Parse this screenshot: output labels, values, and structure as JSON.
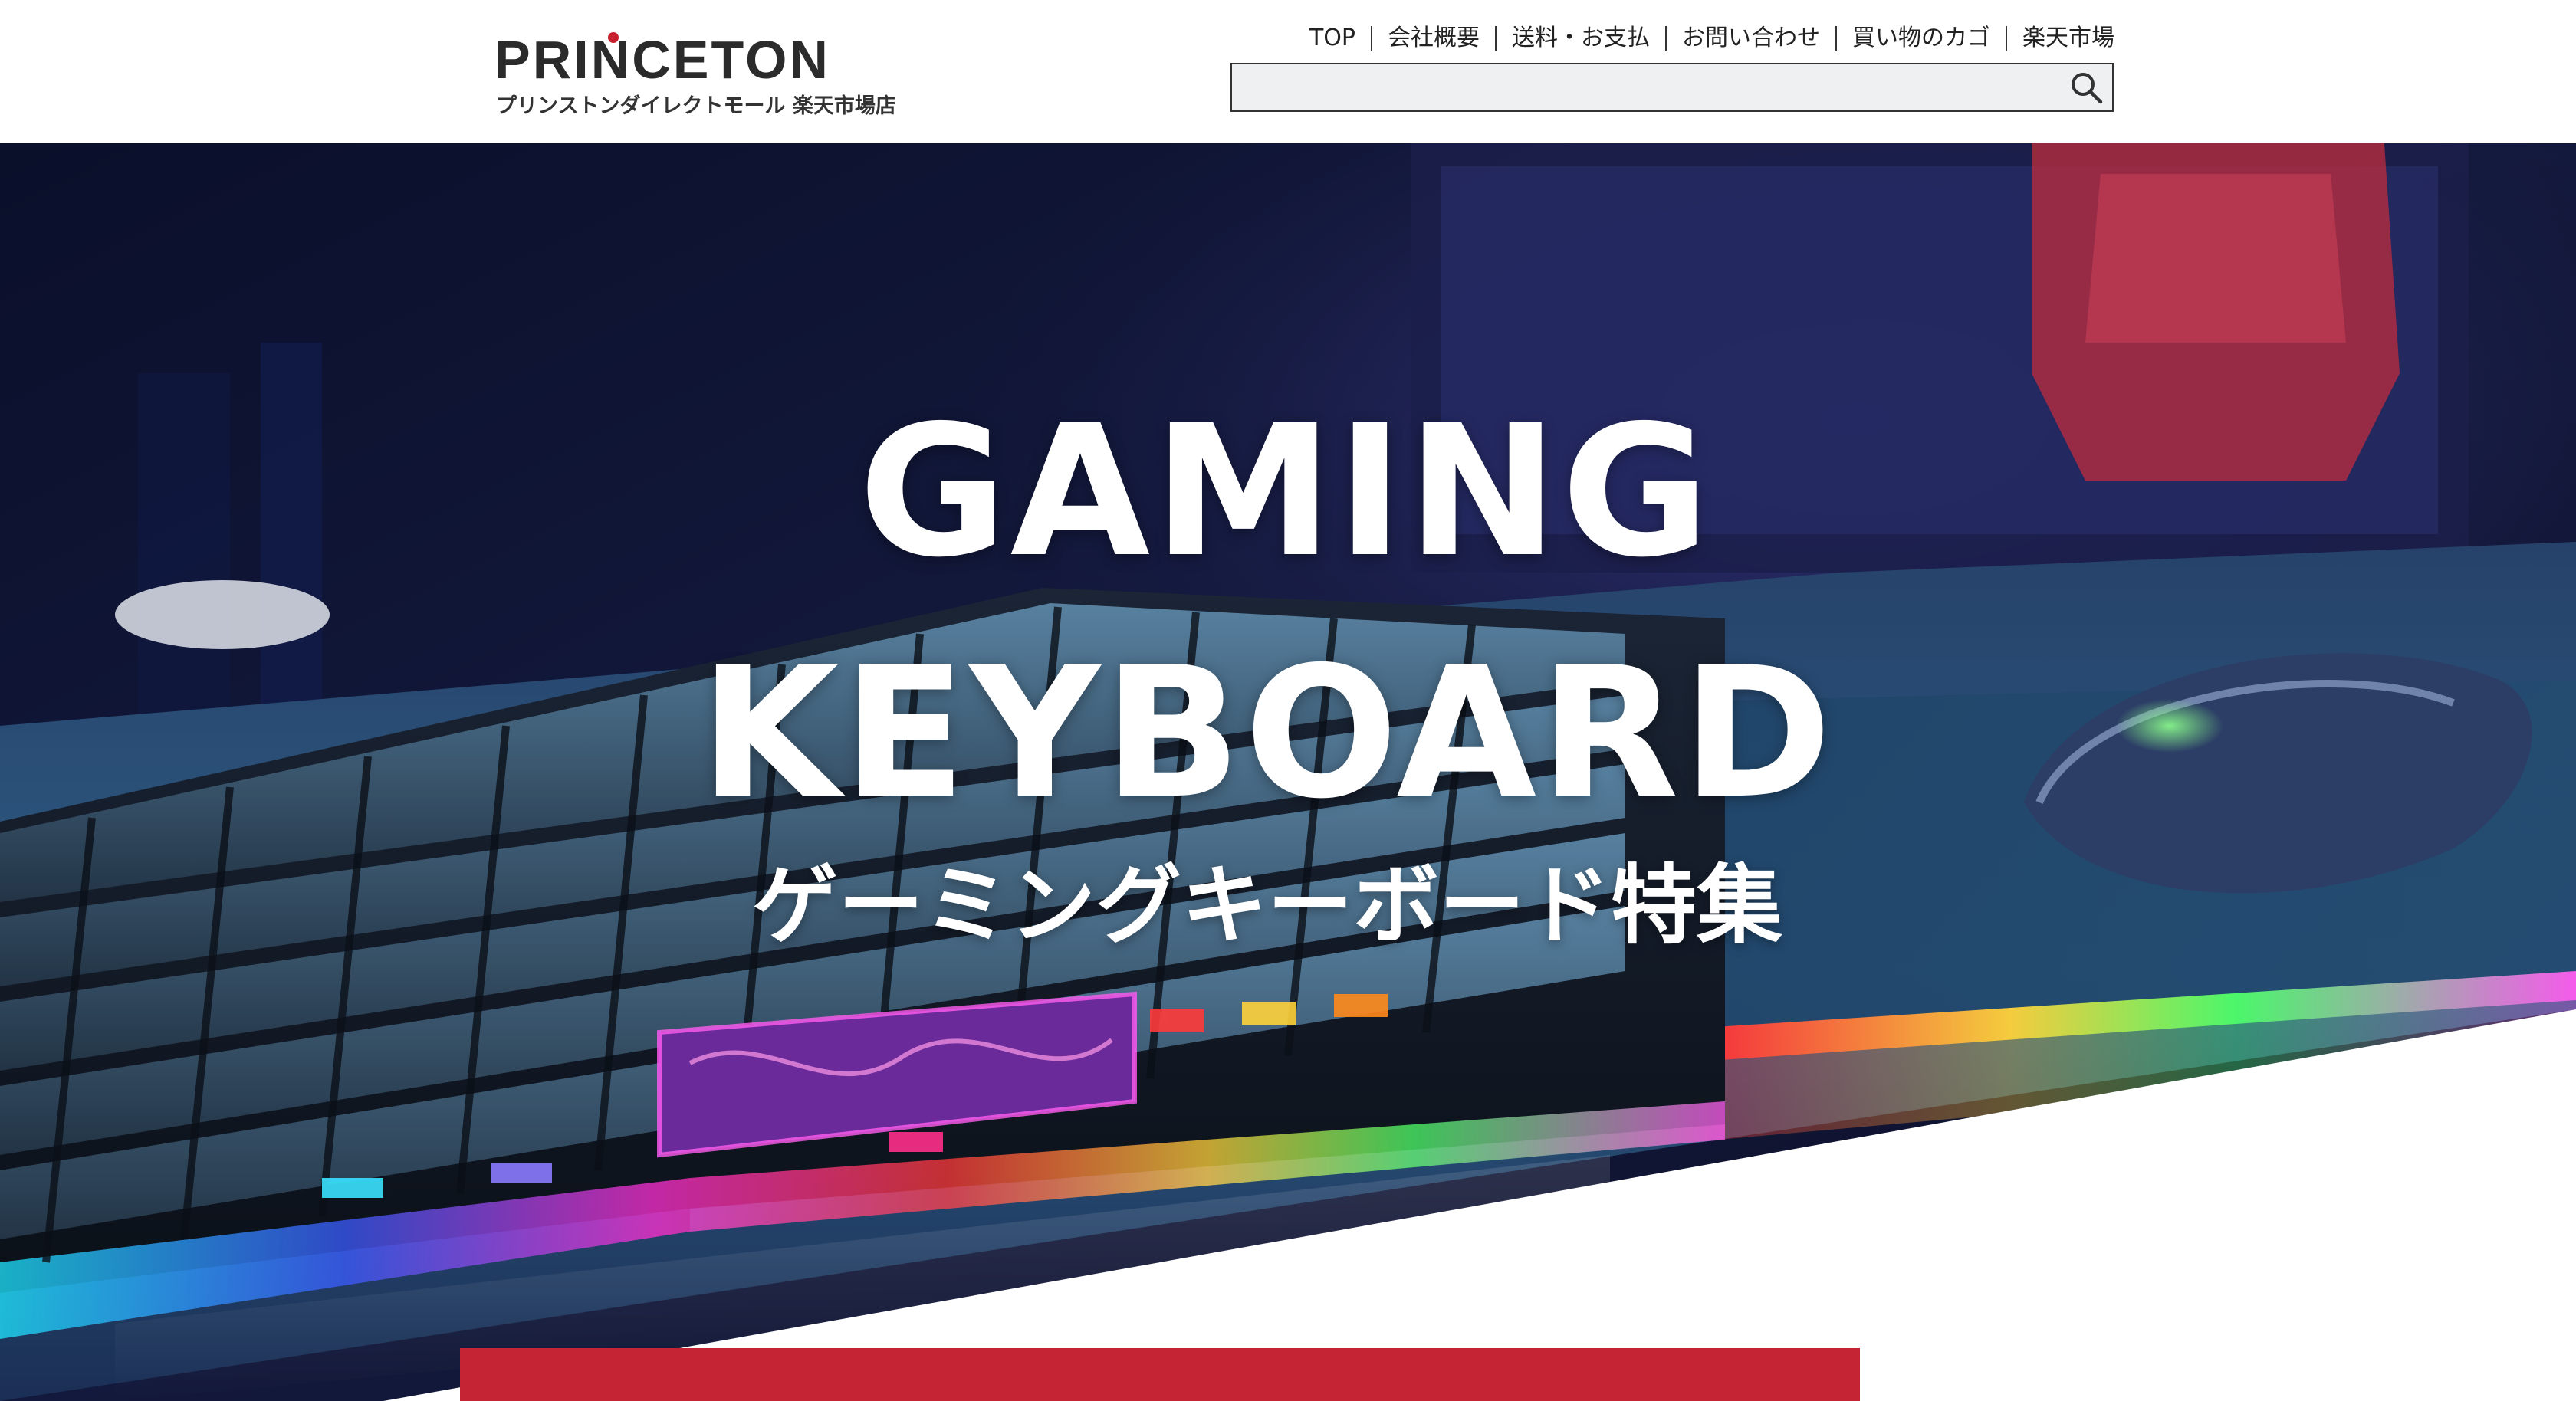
{
  "brand": {
    "logo_text": "PRINCETON",
    "logo_sub": "プリンストンダイレクトモール 楽天市場店",
    "accent_color": "#c42434"
  },
  "topnav": {
    "items": [
      {
        "label": "TOP"
      },
      {
        "label": "会社概要"
      },
      {
        "label": "送料・お支払"
      },
      {
        "label": "お問い合わせ"
      },
      {
        "label": "買い物のカゴ"
      },
      {
        "label": "楽天市場"
      }
    ]
  },
  "search": {
    "value": "",
    "icon": "magnifier-icon"
  },
  "hero": {
    "title_line1": "GAMING",
    "title_line2": "KEYBOARD",
    "subtitle": "ゲーミングキーボード特集",
    "background": "rgb-gaming-keyboard-photo"
  }
}
